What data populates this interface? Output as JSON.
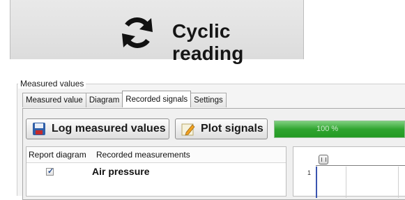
{
  "banner": {
    "title": "Cyclic reading",
    "icon": "refresh-arrows-icon"
  },
  "group": {
    "label": "Measured values"
  },
  "tabs": [
    {
      "label": "Measured value"
    },
    {
      "label": "Diagram"
    },
    {
      "label": "Recorded signals",
      "active": true
    },
    {
      "label": "Settings"
    }
  ],
  "toolbar": {
    "log_label": "Log measured values",
    "log_icon": "floppy-disk-icon",
    "plot_label": "Plot signals",
    "plot_icon": "pencil-chart-icon",
    "progress_text": "100 %",
    "progress_value": 1.0,
    "progress_color": "#3cae3c"
  },
  "table": {
    "headers": [
      "Report diagram",
      "Recorded measurements"
    ],
    "rows": [
      {
        "checked": true,
        "name": "Air pressure"
      }
    ]
  },
  "plot": {
    "y_tick": "1"
  }
}
